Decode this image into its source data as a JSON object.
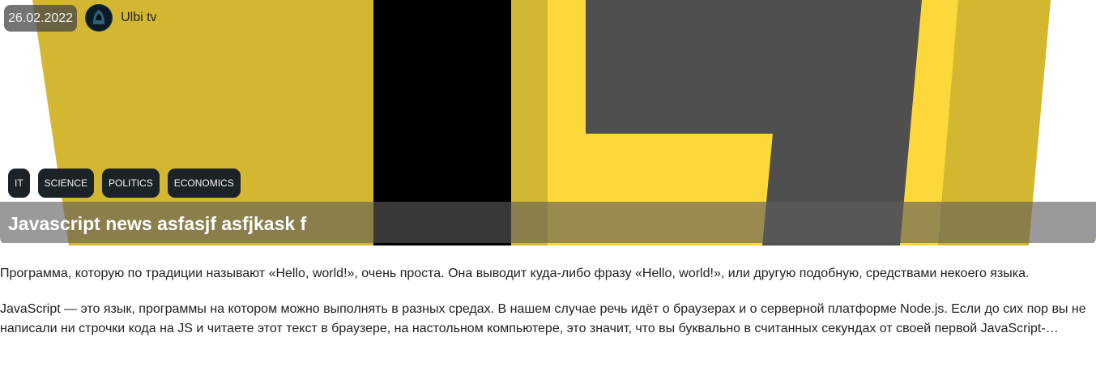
{
  "post": {
    "date": "26.02.2022",
    "author": "Ulbi tv",
    "title": "Javascript news asfasjf asfjkask f",
    "tags": [
      "IT",
      "SCIENCE",
      "POLITICS",
      "ECONOMICS"
    ],
    "paragraphs": [
      "Программа, которую по традиции называют «Hello, world!», очень проста. Она выводит куда-либо фразу «Hello, world!», или другую подобную, средствами некоего языка.",
      "JavaScript — это язык, программы на котором можно выполнять в разных средах. В нашем случае речь идёт о браузерах и о серверной платформе Node.js. Если до сих пор вы не написали ни строчки кода на JS и читаете этот текст в браузере, на настольном компьютере, это значит, что вы буквально в считанных секундах от своей первой JavaScript-…"
    ]
  },
  "image": {
    "subject": "JavaScript logo (JS) on yellow background",
    "colors": {
      "yellow": "#fcd83a",
      "dark_yellow": "#d4b731",
      "black": "#000000",
      "gray": "#4f4f4f"
    }
  }
}
